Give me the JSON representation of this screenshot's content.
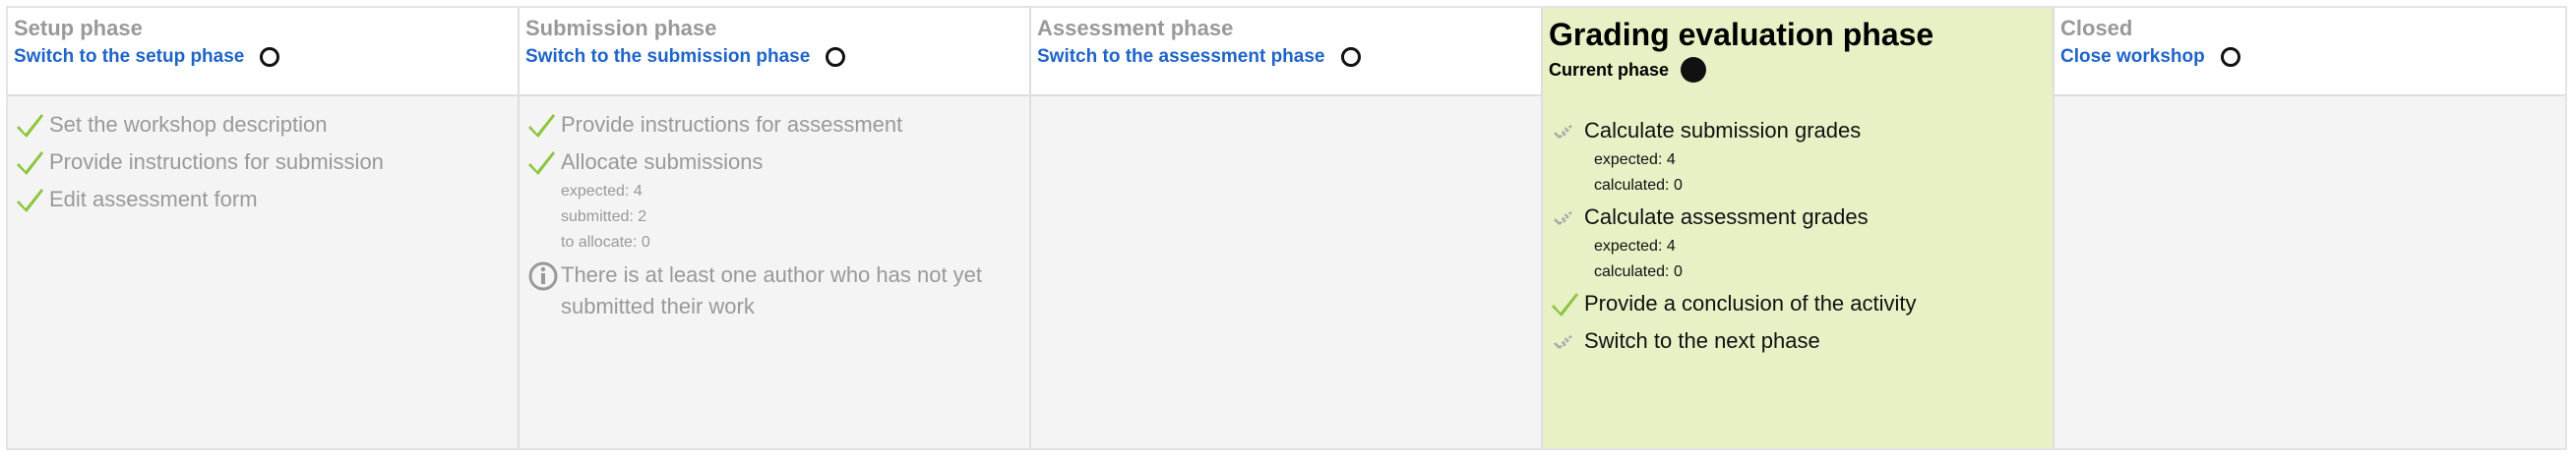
{
  "phases": [
    {
      "title": "Setup phase",
      "switch_label": "Switch to the setup phase",
      "tasks": [
        {
          "label": "Set the workshop description",
          "status": "done"
        },
        {
          "label": "Provide instructions for submission",
          "status": "done"
        },
        {
          "label": "Edit assessment form",
          "status": "done"
        }
      ]
    },
    {
      "title": "Submission phase",
      "switch_label": "Switch to the submission phase",
      "tasks": [
        {
          "label": "Provide instructions for assessment",
          "status": "done"
        },
        {
          "label": "Allocate submissions",
          "status": "done",
          "details": [
            "expected: 4",
            "submitted: 2",
            "to allocate: 0"
          ]
        }
      ],
      "info": "There is at least one author who has not yet submitted their work"
    },
    {
      "title": "Assessment phase",
      "switch_label": "Switch to the assessment phase",
      "tasks": []
    },
    {
      "title": "Grading evaluation phase",
      "current_label": "Current phase",
      "tasks": [
        {
          "label": "Calculate submission grades",
          "status": "todo",
          "details": [
            "expected: 4",
            "calculated: 0"
          ]
        },
        {
          "label": "Calculate assessment grades",
          "status": "todo",
          "details": [
            "expected: 4",
            "calculated: 0"
          ]
        },
        {
          "label": "Provide a conclusion of the activity",
          "status": "done"
        },
        {
          "label": "Switch to the next phase",
          "status": "todo"
        }
      ]
    },
    {
      "title": "Closed",
      "switch_label": "Close workshop",
      "tasks": []
    }
  ],
  "colors": {
    "done_check": "#8cc63f",
    "todo_check": "#aaaaaa",
    "link": "#1e64c8",
    "active_bg": "#e8f0c5"
  }
}
